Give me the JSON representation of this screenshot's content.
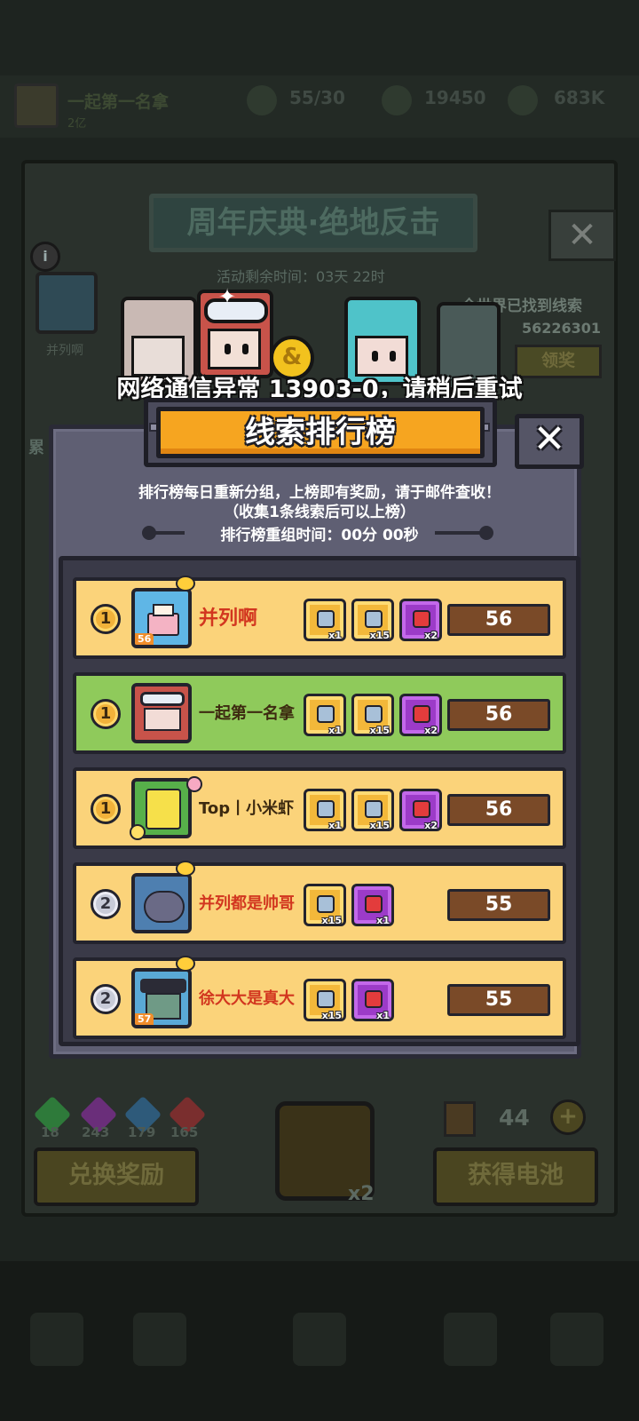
{
  "background": {
    "player_name": "一起第一名拿",
    "player_sub": "2亿",
    "stats": [
      "55/30",
      "19450",
      "683K"
    ],
    "event_title": "周年庆典·绝地反击",
    "event_timer": "活动剩余时间：03天 22时",
    "cake_label": "并列啊",
    "found_text": "全世界已找到线索",
    "found_number": "56226301",
    "claim_label": "领奖",
    "side_label": "累",
    "gems": [
      {
        "count": "18",
        "color": "#2e7a3a"
      },
      {
        "count": "243",
        "color": "#6a2e7a"
      },
      {
        "count": "179",
        "color": "#2e5a7a"
      },
      {
        "count": "165",
        "color": "#7a2e2e"
      }
    ],
    "exchange_label": "兑换奖励",
    "get_battery_label": "获得电池",
    "lock_multiplier": "x2",
    "battery_count": "44"
  },
  "toast": "网络通信异常 13903-0，请稍后重试",
  "modal": {
    "title": "线索排行榜",
    "close_glyph": "✕",
    "desc_line1": "排行榜每日重新分组，上榜即有奖励，请于邮件查收！",
    "desc_line2": "（收集1条线索后可以上榜）",
    "reset_text": "排行榜重组时间：00分 00秒",
    "rows": [
      {
        "rank": "1",
        "name": "并列啊",
        "level": "56",
        "score": "56",
        "style": "gold",
        "rewards": [
          {
            "type": "chest",
            "qty": "x1"
          },
          {
            "type": "chest",
            "qty": "x15"
          },
          {
            "type": "gift",
            "qty": "x2"
          }
        ]
      },
      {
        "rank": "1",
        "name": "一起第一名拿",
        "level": "",
        "score": "56",
        "style": "green",
        "rewards": [
          {
            "type": "chest",
            "qty": "x1"
          },
          {
            "type": "chest",
            "qty": "x15"
          },
          {
            "type": "gift",
            "qty": "x2"
          }
        ]
      },
      {
        "rank": "1",
        "name": "Top丨小米虾",
        "level": "",
        "score": "56",
        "style": "gold",
        "rewards": [
          {
            "type": "chest",
            "qty": "x1"
          },
          {
            "type": "chest",
            "qty": "x15"
          },
          {
            "type": "gift",
            "qty": "x2"
          }
        ]
      },
      {
        "rank": "2",
        "name": "并列都是帅哥",
        "level": "",
        "score": "55",
        "style": "gold",
        "rewards": [
          {
            "type": "chest",
            "qty": "x15"
          },
          {
            "type": "gift",
            "qty": "x1"
          }
        ]
      },
      {
        "rank": "2",
        "name": "徐大大是真大",
        "level": "57",
        "score": "55",
        "style": "gold",
        "rewards": [
          {
            "type": "chest",
            "qty": "x15"
          },
          {
            "type": "gift",
            "qty": "x1"
          }
        ]
      }
    ]
  },
  "colors": {
    "row_gold": "#fbd37a",
    "row_green": "#8fca5b",
    "title_orange": "#f6a520",
    "score_brown": "#7a4a28"
  }
}
